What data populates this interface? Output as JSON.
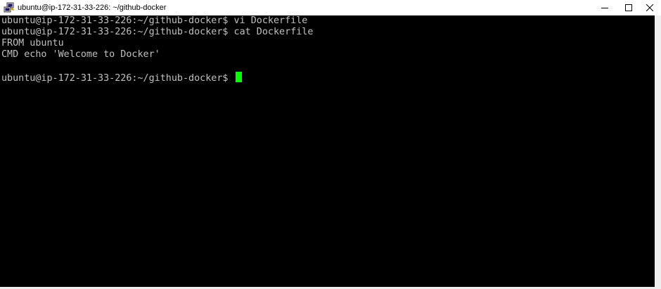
{
  "window": {
    "title": "ubuntu@ip-172-31-33-226: ~/github-docker",
    "app_icon": "putty-icon",
    "controls": {
      "minimize_icon": "minimize-icon",
      "maximize_icon": "maximize-icon",
      "close_icon": "close-icon"
    }
  },
  "terminal": {
    "lines": [
      "ubuntu@ip-172-31-33-226:~/github-docker$ vi Dockerfile",
      "ubuntu@ip-172-31-33-226:~/github-docker$ cat Dockerfile",
      "FROM ubuntu",
      "CMD echo 'Welcome to Docker'",
      "",
      "ubuntu@ip-172-31-33-226:~/github-docker$ "
    ],
    "cursor_color": "#00ff00",
    "text_color": "#c0c0c0",
    "background_color": "#000000"
  }
}
